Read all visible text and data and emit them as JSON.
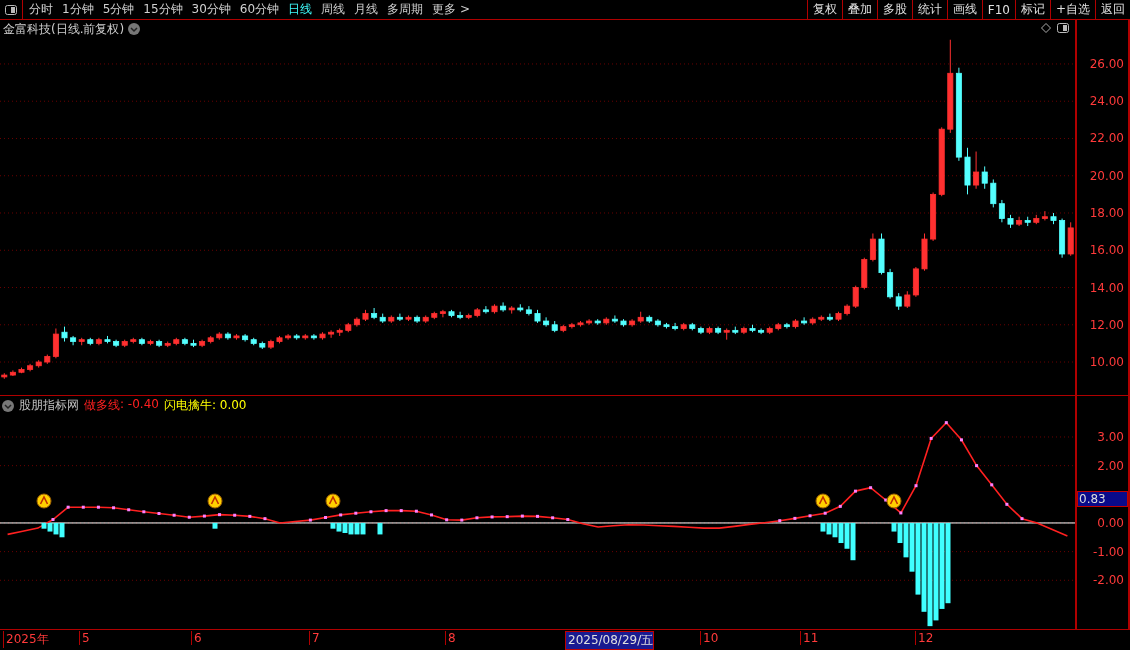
{
  "toolbar": {
    "periods": [
      {
        "label": "分时",
        "selected": false
      },
      {
        "label": "1分钟",
        "selected": false
      },
      {
        "label": "5分钟",
        "selected": false
      },
      {
        "label": "15分钟",
        "selected": false
      },
      {
        "label": "30分钟",
        "selected": false
      },
      {
        "label": "60分钟",
        "selected": false
      },
      {
        "label": "日线",
        "selected": true
      },
      {
        "label": "周线",
        "selected": false
      },
      {
        "label": "月线",
        "selected": false
      },
      {
        "label": "多周期",
        "selected": false
      },
      {
        "label": "更多 >",
        "selected": false
      }
    ],
    "actions": [
      "复权",
      "叠加",
      "多股",
      "统计",
      "画线",
      "F10",
      "标记",
      "+自选",
      "返回"
    ]
  },
  "chart_title": "金富科技(日线.前复权)",
  "price_chart": {
    "chart_data": {
      "type": "candlestick",
      "grid": true,
      "ylim": [
        8.23,
        28.36
      ],
      "yticks": [
        {
          "value": 26,
          "label": "26.00"
        },
        {
          "value": 24,
          "label": "24.00"
        },
        {
          "value": 22,
          "label": "22.00"
        },
        {
          "value": 20,
          "label": "20.00"
        },
        {
          "value": 18,
          "label": "18.00"
        },
        {
          "value": 16,
          "label": "16.00"
        },
        {
          "value": 14,
          "label": "14.00"
        },
        {
          "value": 12,
          "label": "12.00"
        },
        {
          "value": 10,
          "label": "10.00"
        }
      ],
      "categories": [
        null,
        null,
        null,
        null,
        null,
        null,
        null,
        null,
        null,
        null,
        null,
        null,
        null,
        null,
        null,
        null,
        null,
        null,
        null,
        null,
        null,
        null,
        null,
        null,
        null,
        null,
        null,
        null,
        null,
        null,
        null,
        null,
        null,
        null,
        null,
        null,
        null,
        null,
        null,
        null,
        null,
        null,
        null,
        null,
        null,
        null,
        null,
        null,
        null,
        null,
        null,
        null,
        null,
        null,
        null,
        null,
        null,
        null,
        null,
        null,
        null,
        null,
        null,
        null,
        null,
        null,
        null,
        null,
        null,
        null,
        null,
        null,
        null,
        null,
        null,
        null,
        null,
        null,
        null,
        null,
        null,
        null,
        null,
        null,
        null,
        null,
        null,
        null,
        null,
        null,
        null,
        null,
        null,
        null,
        null,
        null,
        null,
        null,
        null,
        null,
        null,
        null,
        null,
        null,
        null,
        null,
        null,
        null,
        null,
        null,
        null,
        null,
        null,
        null,
        null,
        null,
        null,
        null,
        null,
        null,
        null,
        null,
        null,
        null,
        null
      ],
      "ohlc": [
        [
          9.2,
          9.4,
          9.1,
          9.3
        ],
        [
          9.3,
          9.55,
          9.25,
          9.45
        ],
        [
          9.45,
          9.7,
          9.4,
          9.6
        ],
        [
          9.6,
          9.9,
          9.5,
          9.8
        ],
        [
          9.8,
          10.1,
          9.7,
          10.0
        ],
        [
          10.0,
          10.4,
          9.9,
          10.3
        ],
        [
          10.3,
          11.8,
          10.2,
          11.5
        ],
        [
          11.6,
          11.9,
          11.1,
          11.3
        ],
        [
          11.3,
          11.4,
          10.9,
          11.1
        ],
        [
          11.1,
          11.3,
          10.9,
          11.2
        ],
        [
          11.2,
          11.3,
          10.9,
          11.0
        ],
        [
          11.0,
          11.3,
          10.9,
          11.2
        ],
        [
          11.2,
          11.4,
          11.0,
          11.1
        ],
        [
          11.1,
          11.2,
          10.8,
          10.9
        ],
        [
          10.9,
          11.2,
          10.8,
          11.1
        ],
        [
          11.1,
          11.3,
          11.0,
          11.2
        ],
        [
          11.2,
          11.3,
          10.9,
          11.0
        ],
        [
          11.0,
          11.2,
          10.9,
          11.1
        ],
        [
          11.1,
          11.2,
          10.8,
          10.9
        ],
        [
          10.9,
          11.1,
          10.8,
          11.0
        ],
        [
          11.0,
          11.3,
          10.9,
          11.2
        ],
        [
          11.2,
          11.3,
          10.9,
          11.0
        ],
        [
          11.0,
          11.2,
          10.8,
          10.9
        ],
        [
          10.9,
          11.2,
          10.8,
          11.1
        ],
        [
          11.1,
          11.4,
          11.0,
          11.3
        ],
        [
          11.3,
          11.6,
          11.2,
          11.5
        ],
        [
          11.5,
          11.6,
          11.2,
          11.3
        ],
        [
          11.3,
          11.5,
          11.2,
          11.4
        ],
        [
          11.4,
          11.5,
          11.1,
          11.2
        ],
        [
          11.2,
          11.3,
          10.9,
          11.0
        ],
        [
          11.0,
          11.1,
          10.7,
          10.8
        ],
        [
          10.8,
          11.2,
          10.7,
          11.1
        ],
        [
          11.1,
          11.4,
          11.0,
          11.3
        ],
        [
          11.3,
          11.5,
          11.2,
          11.4
        ],
        [
          11.4,
          11.5,
          11.2,
          11.3
        ],
        [
          11.3,
          11.5,
          11.2,
          11.4
        ],
        [
          11.4,
          11.5,
          11.2,
          11.3
        ],
        [
          11.3,
          11.6,
          11.2,
          11.5
        ],
        [
          11.5,
          11.7,
          11.3,
          11.6
        ],
        [
          11.6,
          11.8,
          11.4,
          11.7
        ],
        [
          11.7,
          12.1,
          11.6,
          12.0
        ],
        [
          12.0,
          12.4,
          11.9,
          12.3
        ],
        [
          12.3,
          12.8,
          12.2,
          12.6
        ],
        [
          12.6,
          12.9,
          12.3,
          12.4
        ],
        [
          12.4,
          12.6,
          12.1,
          12.2
        ],
        [
          12.2,
          12.5,
          12.1,
          12.4
        ],
        [
          12.4,
          12.6,
          12.2,
          12.3
        ],
        [
          12.3,
          12.5,
          12.2,
          12.4
        ],
        [
          12.4,
          12.5,
          12.1,
          12.2
        ],
        [
          12.2,
          12.5,
          12.1,
          12.4
        ],
        [
          12.4,
          12.7,
          12.3,
          12.6
        ],
        [
          12.6,
          12.8,
          12.4,
          12.7
        ],
        [
          12.7,
          12.8,
          12.4,
          12.5
        ],
        [
          12.5,
          12.7,
          12.3,
          12.4
        ],
        [
          12.4,
          12.6,
          12.3,
          12.5
        ],
        [
          12.5,
          12.9,
          12.4,
          12.8
        ],
        [
          12.8,
          13.0,
          12.6,
          12.7
        ],
        [
          12.7,
          13.1,
          12.6,
          13.0
        ],
        [
          13.0,
          13.2,
          12.7,
          12.8
        ],
        [
          12.8,
          13.0,
          12.6,
          12.9
        ],
        [
          12.9,
          13.1,
          12.7,
          12.8
        ],
        [
          12.8,
          13.0,
          12.5,
          12.6
        ],
        [
          12.6,
          12.8,
          12.1,
          12.2
        ],
        [
          12.2,
          12.4,
          11.9,
          12.0
        ],
        [
          12.0,
          12.2,
          11.6,
          11.7
        ],
        [
          11.7,
          12.0,
          11.6,
          11.9
        ],
        [
          11.9,
          12.1,
          11.8,
          12.0
        ],
        [
          12.0,
          12.2,
          11.9,
          12.1
        ],
        [
          12.1,
          12.3,
          12.0,
          12.2
        ],
        [
          12.2,
          12.3,
          12.0,
          12.1
        ],
        [
          12.1,
          12.4,
          12.0,
          12.3
        ],
        [
          12.3,
          12.5,
          12.1,
          12.2
        ],
        [
          12.2,
          12.3,
          11.9,
          12.0
        ],
        [
          12.0,
          12.3,
          11.9,
          12.2
        ],
        [
          12.2,
          12.7,
          12.1,
          12.4
        ],
        [
          12.4,
          12.5,
          12.1,
          12.2
        ],
        [
          12.2,
          12.3,
          11.9,
          12.0
        ],
        [
          12.0,
          12.1,
          11.8,
          11.9
        ],
        [
          11.9,
          12.1,
          11.7,
          11.8
        ],
        [
          11.8,
          12.1,
          11.7,
          12.0
        ],
        [
          12.0,
          12.1,
          11.7,
          11.8
        ],
        [
          11.8,
          11.9,
          11.5,
          11.6
        ],
        [
          11.6,
          11.9,
          11.5,
          11.8
        ],
        [
          11.8,
          11.9,
          11.5,
          11.6
        ],
        [
          11.6,
          11.8,
          11.2,
          11.7
        ],
        [
          11.7,
          11.9,
          11.5,
          11.6
        ],
        [
          11.6,
          11.9,
          11.5,
          11.8
        ],
        [
          11.8,
          12.0,
          11.6,
          11.7
        ],
        [
          11.7,
          11.8,
          11.5,
          11.6
        ],
        [
          11.6,
          11.9,
          11.5,
          11.8
        ],
        [
          11.8,
          12.1,
          11.7,
          12.0
        ],
        [
          12.0,
          12.1,
          11.8,
          11.9
        ],
        [
          11.9,
          12.3,
          11.8,
          12.2
        ],
        [
          12.2,
          12.4,
          12.0,
          12.1
        ],
        [
          12.1,
          12.4,
          12.0,
          12.3
        ],
        [
          12.3,
          12.5,
          12.2,
          12.4
        ],
        [
          12.4,
          12.6,
          12.2,
          12.3
        ],
        [
          12.3,
          12.7,
          12.2,
          12.6
        ],
        [
          12.6,
          13.1,
          12.5,
          13.0
        ],
        [
          13.0,
          14.1,
          12.9,
          14.0
        ],
        [
          14.0,
          15.6,
          13.9,
          15.5
        ],
        [
          15.5,
          16.9,
          15.4,
          16.6
        ],
        [
          16.6,
          16.9,
          14.7,
          14.8
        ],
        [
          14.8,
          15.0,
          13.4,
          13.5
        ],
        [
          13.5,
          13.7,
          12.8,
          13.0
        ],
        [
          13.0,
          13.8,
          12.9,
          13.6
        ],
        [
          13.6,
          15.1,
          13.5,
          15.0
        ],
        [
          15.0,
          16.9,
          14.9,
          16.6
        ],
        [
          16.6,
          19.1,
          16.5,
          19.0
        ],
        [
          19.0,
          22.6,
          18.9,
          22.5
        ],
        [
          22.5,
          27.3,
          22.3,
          25.5
        ],
        [
          25.5,
          25.8,
          20.8,
          21.0
        ],
        [
          21.0,
          21.5,
          19.0,
          19.5
        ],
        [
          19.5,
          21.3,
          19.3,
          20.2
        ],
        [
          20.2,
          20.5,
          19.3,
          19.6
        ],
        [
          19.6,
          19.8,
          18.3,
          18.5
        ],
        [
          18.5,
          18.7,
          17.5,
          17.7
        ],
        [
          17.7,
          17.9,
          17.2,
          17.4
        ],
        [
          17.4,
          17.8,
          17.3,
          17.6
        ],
        [
          17.6,
          17.8,
          17.3,
          17.5
        ],
        [
          17.5,
          17.9,
          17.4,
          17.7
        ],
        [
          17.7,
          18.1,
          17.6,
          17.8
        ],
        [
          17.8,
          18.0,
          17.4,
          17.6
        ],
        [
          17.6,
          17.7,
          15.6,
          15.8
        ],
        [
          15.8,
          17.5,
          15.7,
          17.2
        ]
      ]
    }
  },
  "indicator": {
    "name": "股朋指标网",
    "line_value": ": -0.40",
    "lines": [
      {
        "label": "闪电擒牛: 0.00",
        "color": "#ffff00"
      }
    ],
    "current_value": "0.83",
    "chart_data": {
      "type": "line",
      "grid": true,
      "ylim": [
        -3.7,
        4.43
      ],
      "categories": [
        null,
        null,
        null,
        null,
        null,
        null,
        null,
        null,
        null,
        null,
        null,
        null,
        null,
        null,
        null,
        null,
        null,
        null,
        null,
        null,
        null,
        null,
        null,
        null,
        null,
        null,
        null,
        null,
        null,
        null,
        null,
        null,
        null,
        null,
        null,
        null,
        null,
        null,
        null,
        null,
        null,
        null,
        null,
        null,
        null,
        null,
        null,
        null,
        null,
        null,
        null,
        null,
        null,
        null,
        null,
        null,
        null,
        null,
        null,
        null,
        null,
        null,
        null,
        null,
        null,
        null,
        null,
        null,
        null,
        null,
        null
      ],
      "series": [
        {
          "name": "做多线",
          "color": "#ff2020",
          "values": [
            -0.4,
            -0.29,
            -0.18,
            0.12,
            0.55,
            0.55,
            0.55,
            0.53,
            0.46,
            0.39,
            0.33,
            0.27,
            0.2,
            0.24,
            0.29,
            0.27,
            0.23,
            0.15,
            0,
            0.05,
            0.1,
            0.19,
            0.28,
            0.34,
            0.39,
            0.43,
            0.43,
            0.41,
            0.28,
            0.11,
            0.1,
            0.18,
            0.21,
            0.22,
            0.24,
            0.23,
            0.18,
            0.12,
            -0.03,
            -0.14,
            -0.1,
            -0.06,
            -0.07,
            -0.1,
            -0.12,
            -0.15,
            -0.18,
            -0.18,
            -0.12,
            -0.05,
            0.01,
            0.08,
            0.16,
            0.25,
            0.34,
            0.58,
            1.11,
            1.23,
            0.8,
            0.35,
            1.3,
            2.95,
            3.5,
            2.9,
            2.0,
            1.33,
            0.65,
            0.15,
            0,
            -0.23,
            -0.45
          ]
        }
      ],
      "yticks": [
        {
          "value": 3,
          "label": "3.00"
        },
        {
          "value": 2,
          "label": "2.00"
        },
        {
          "value": 0,
          "label": "0.00"
        },
        {
          "value": -1,
          "label": "-1.00"
        },
        {
          "value": -2,
          "label": "-2.00"
        }
      ]
    }
  },
  "date_axis": [
    {
      "label": "2025年",
      "selected": false
    },
    {
      "label": "5",
      "selected": false
    },
    {
      "label": "6",
      "selected": false
    },
    {
      "label": "7",
      "selected": false
    },
    {
      "label": "8",
      "selected": false
    },
    {
      "label": "2025/08/29/五",
      "selected": true
    },
    {
      "label": "10",
      "selected": false
    },
    {
      "label": "11",
      "selected": false
    },
    {
      "label": "12",
      "selected": false
    }
  ]
}
